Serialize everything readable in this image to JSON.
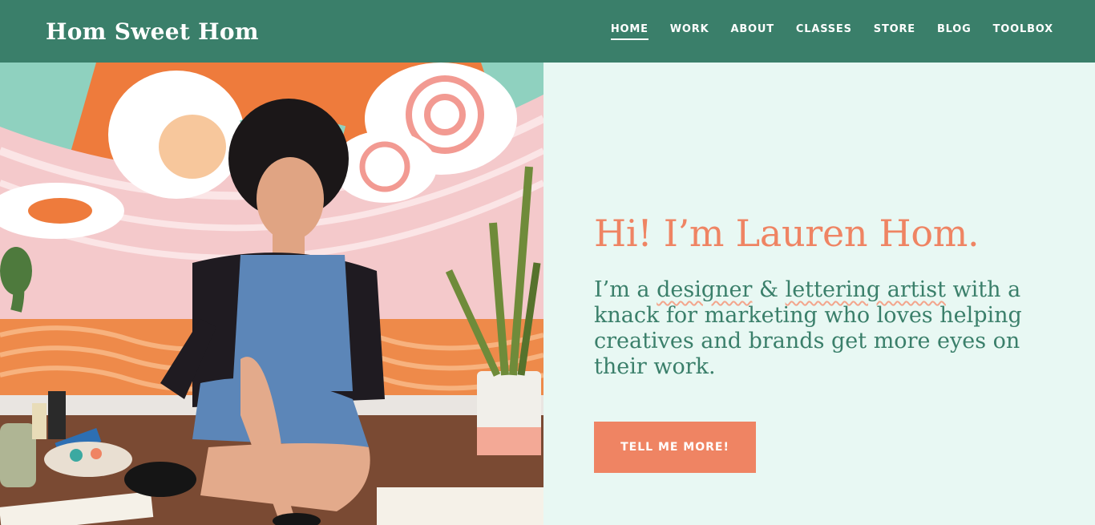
{
  "header": {
    "logo": "Hom Sweet Hom",
    "nav": [
      {
        "label": "HOME",
        "active": true
      },
      {
        "label": "WORK",
        "active": false
      },
      {
        "label": "ABOUT",
        "active": false
      },
      {
        "label": "CLASSES",
        "active": false
      },
      {
        "label": "STORE",
        "active": false
      },
      {
        "label": "BLOG",
        "active": false
      },
      {
        "label": "TOOLBOX",
        "active": false
      }
    ]
  },
  "hero": {
    "title": "Hi! I’m Lauren Hom.",
    "intro_prefix": "I’m a ",
    "highlight_1": "designer",
    "amp": " & ",
    "highlight_2": "lettering artist",
    "intro_suffix": " with a knack for marketing who loves helping creatives and brands get more eyes on their work.",
    "cta_label": "TELL ME MORE!"
  },
  "colors": {
    "header_bg": "#3a7f6a",
    "page_bg": "#e8f8f3",
    "accent": "#ef8463",
    "text_green": "#3a7f6a"
  }
}
